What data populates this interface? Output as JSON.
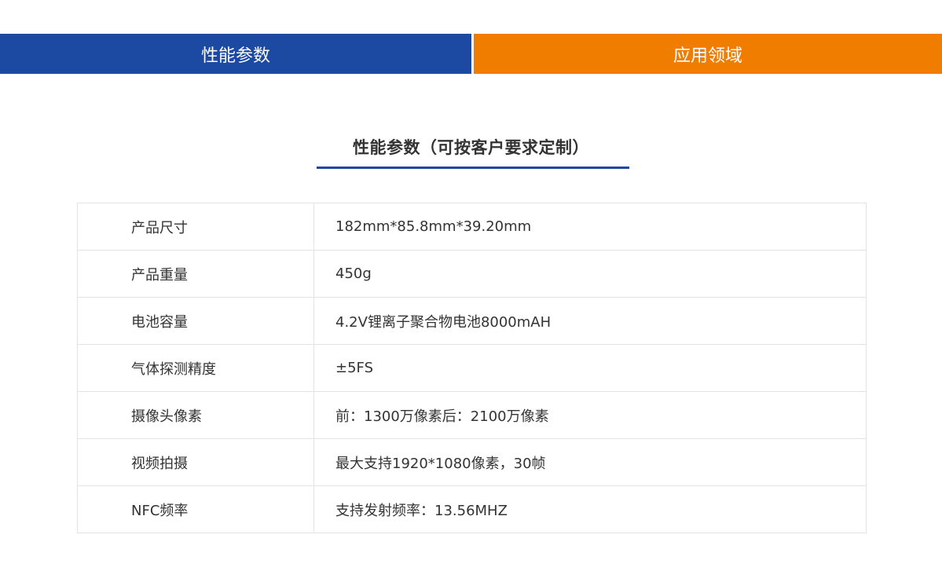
{
  "tabs": [
    {
      "label": "性能参数",
      "color": "#1c4aa2",
      "active": true
    },
    {
      "label": "应用领域",
      "color": "#f07d00",
      "active": false
    }
  ],
  "section": {
    "title": "性能参数（可按客户要求定制）",
    "underline_color": "#1c4aa2"
  },
  "specs": [
    {
      "label": "产品尺寸",
      "value": "182mm*85.8mm*39.20mm"
    },
    {
      "label": "产品重量",
      "value": "450g"
    },
    {
      "label": "电池容量",
      "value": "4.2V锂离子聚合物电池8000mAH"
    },
    {
      "label": "气体探测精度",
      "value": "±5FS"
    },
    {
      "label": "摄像头像素",
      "value": "前：1300万像素后：2100万像素"
    },
    {
      "label": "视频拍摄",
      "value": "最大支持1920*1080像素，30帧"
    },
    {
      "label": "NFC频率",
      "value": "支持发射频率：13.56MHZ"
    }
  ]
}
